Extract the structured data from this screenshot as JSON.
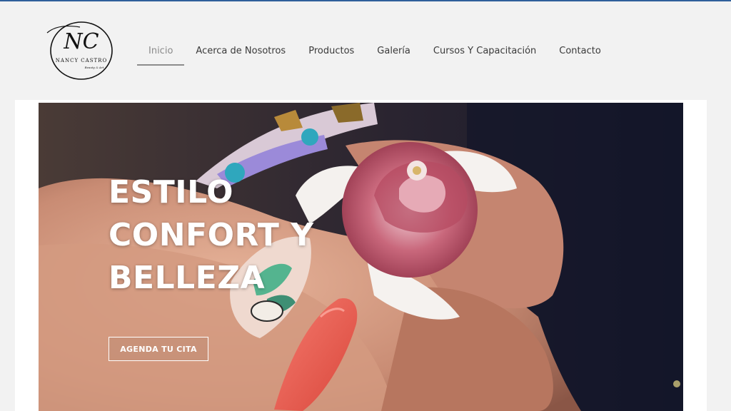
{
  "brand": {
    "monogram": "NC",
    "name": "NANCY CASTRO",
    "tagline": "Beauty & Art"
  },
  "nav": {
    "items": [
      {
        "label": "Inicio",
        "active": true
      },
      {
        "label": "Acerca de Nosotros"
      },
      {
        "label": "Productos"
      },
      {
        "label": "Galería"
      },
      {
        "label": "Cursos Y Capacitación"
      },
      {
        "label": "Contacto"
      }
    ]
  },
  "hero": {
    "title_lines": [
      "ESTILO",
      "CONFORT Y",
      "BELLEZA"
    ],
    "cta_label": "AGENDA TU CITA"
  },
  "colors": {
    "top_line": "#2f5f9b",
    "header_bg": "#f2f2f2",
    "active_underline": "#8c8c8c"
  }
}
